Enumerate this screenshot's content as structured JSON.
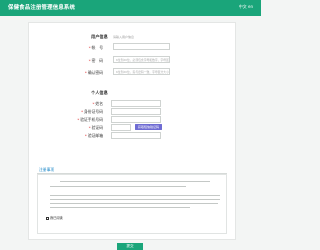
{
  "header": {
    "title": "保健食品注册管理信息系统",
    "lang": "中文 en"
  },
  "account": {
    "section_title": "用户信息",
    "section_note": "请输入用户信息",
    "fields": [
      {
        "label": "帐　号",
        "value": ""
      },
      {
        "label": "密　码",
        "value": "6位到20位，必须包含字母和数字，字母区分大小写"
      },
      {
        "label": "确认密码",
        "value": "6位到20位，需与密码一致，字母区分大小写"
      }
    ]
  },
  "personal": {
    "section_title": "个人信息",
    "fields": [
      {
        "label": "姓名",
        "value": ""
      },
      {
        "label": "身份证号码",
        "value": ""
      },
      {
        "label": "验证手机号码",
        "value": ""
      },
      {
        "label": "验证码",
        "value": ""
      },
      {
        "label": "验证邮箱",
        "value": ""
      }
    ],
    "sms_button": "获取短信验证码"
  },
  "terms": {
    "title": "注册事项",
    "agree_label": "我已阅读"
  },
  "submit_label": "提交",
  "colors": {
    "brand": "#1aa57a",
    "sms_button": "#6f6cd3",
    "required": "#e03a3a"
  }
}
